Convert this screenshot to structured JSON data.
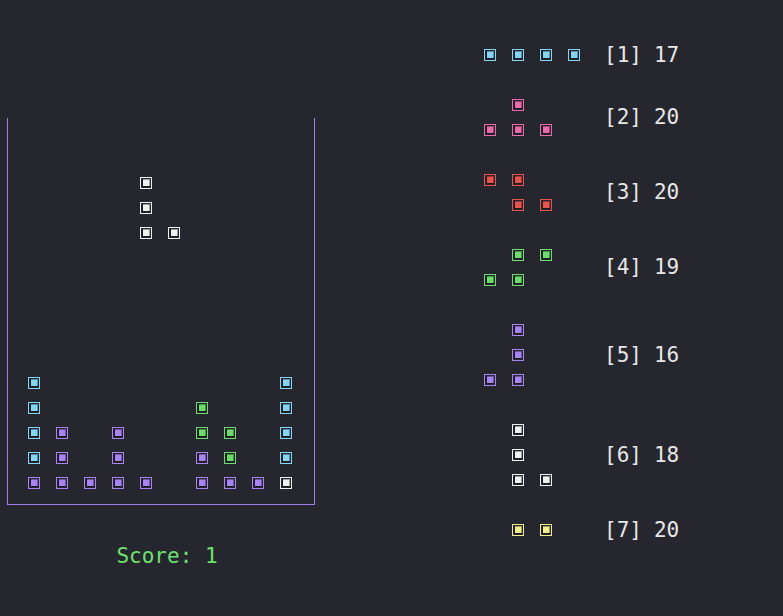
{
  "board": {
    "rows": [
      [
        null,
        null,
        null,
        null,
        null,
        null,
        null,
        null,
        null,
        null
      ],
      [
        null,
        null,
        null,
        null,
        null,
        null,
        null,
        null,
        null,
        null
      ],
      [
        null,
        null,
        null,
        null,
        "#f0f0f0",
        null,
        null,
        null,
        null,
        null
      ],
      [
        null,
        null,
        null,
        null,
        "#f0f0f0",
        null,
        null,
        null,
        null,
        null
      ],
      [
        null,
        null,
        null,
        null,
        "#f0f0f0",
        "#f0f0f0",
        null,
        null,
        null,
        null
      ],
      [
        null,
        null,
        null,
        null,
        null,
        null,
        null,
        null,
        null,
        null
      ],
      [
        null,
        null,
        null,
        null,
        null,
        null,
        null,
        null,
        null,
        null
      ],
      [
        null,
        null,
        null,
        null,
        null,
        null,
        null,
        null,
        null,
        null
      ],
      [
        null,
        null,
        null,
        null,
        null,
        null,
        null,
        null,
        null,
        null
      ],
      [
        null,
        null,
        null,
        null,
        null,
        null,
        null,
        null,
        null,
        null
      ],
      [
        "#86d4f5",
        null,
        null,
        null,
        null,
        null,
        null,
        null,
        null,
        "#86d4f5"
      ],
      [
        "#86d4f5",
        null,
        null,
        null,
        null,
        null,
        "#6ddc6d",
        null,
        null,
        "#86d4f5"
      ],
      [
        "#86d4f5",
        "#a884f3",
        null,
        "#a884f3",
        null,
        null,
        "#6ddc6d",
        "#6ddc6d",
        null,
        "#86d4f5"
      ],
      [
        "#86d4f5",
        "#a884f3",
        null,
        "#a884f3",
        null,
        null,
        "#a884f3",
        "#6ddc6d",
        null,
        "#86d4f5"
      ],
      [
        "#a884f3",
        "#a884f3",
        "#a884f3",
        "#a884f3",
        "#a884f3",
        null,
        "#a884f3",
        "#a884f3",
        "#a884f3",
        "#f0f0f0"
      ]
    ]
  },
  "score": "Score: 1",
  "pieces": [
    {
      "label": "[1]",
      "count": "17",
      "color": "#86d4f5",
      "shape": [
        "####"
      ]
    },
    {
      "label": "[2]",
      "count": "20",
      "color": "#e86aa8",
      "shape": [
        ".#.",
        "###"
      ]
    },
    {
      "label": "[3]",
      "count": "20",
      "color": "#e8554f",
      "shape": [
        "##.",
        ".##"
      ]
    },
    {
      "label": "[4]",
      "count": "19",
      "color": "#6ddc6d",
      "shape": [
        ".##",
        "##."
      ]
    },
    {
      "label": "[5]",
      "count": "16",
      "color": "#a884f3",
      "shape": [
        ".#",
        ".#",
        "##"
      ]
    },
    {
      "label": "[6]",
      "count": "18",
      "color": "#f0f0f0",
      "shape": [
        ".#.",
        ".#.",
        ".##"
      ]
    },
    {
      "label": "[7]",
      "count": "20",
      "color": "#f0ee8a",
      "shape": [
        ".##."
      ]
    }
  ]
}
